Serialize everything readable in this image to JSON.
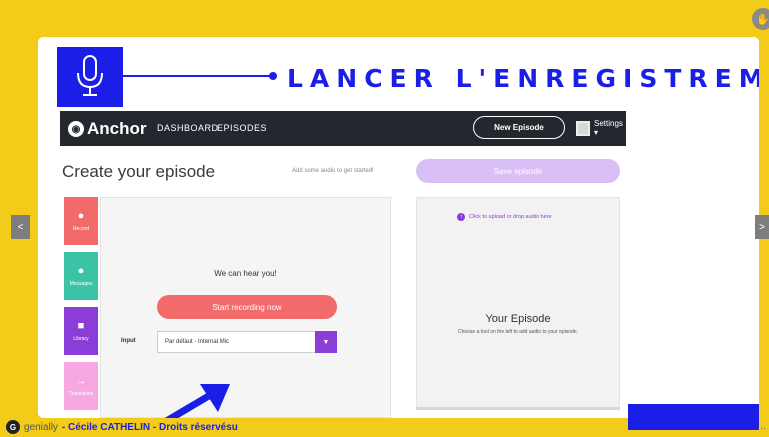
{
  "slide": {
    "title": "LANCER L'ENREGISTREMENT",
    "accent_color": "#1a1ee6",
    "background_color": "#f2cc18"
  },
  "anchor": {
    "logo_text": "Anchor",
    "nav": [
      "DASHBOARD",
      "EPISODES"
    ],
    "new_episode": "New Episode",
    "settings": "Settings ▾",
    "create_title": "Create your episode",
    "hint": "Add some audio to get started!",
    "save_label": "Save episode",
    "tools": [
      {
        "label": "Record",
        "icon": "mic-icon",
        "color": "#f26a6a"
      },
      {
        "label": "Messages",
        "icon": "message-icon",
        "color": "#3cc3a6"
      },
      {
        "label": "Library",
        "icon": "folder-icon",
        "color": "#8a3ed7"
      },
      {
        "label": "Transitions",
        "icon": "arrow-icon",
        "color": "#f7a8e0"
      }
    ],
    "hear_text": "We can hear you!",
    "start_label": "Start recording now",
    "input_label": "Input",
    "input_value": "Par défaut - Internal Mic",
    "upload_text": "Click to upload or drop audio here",
    "episode_title": "Your Episode",
    "episode_hint": "Choose a tool on the left to add audio to your episode."
  },
  "footer": {
    "brand": "genially",
    "credit": "- Cécile CATHELIN - Droits réservésu"
  },
  "nav": {
    "prev": "<",
    "next": ">"
  }
}
